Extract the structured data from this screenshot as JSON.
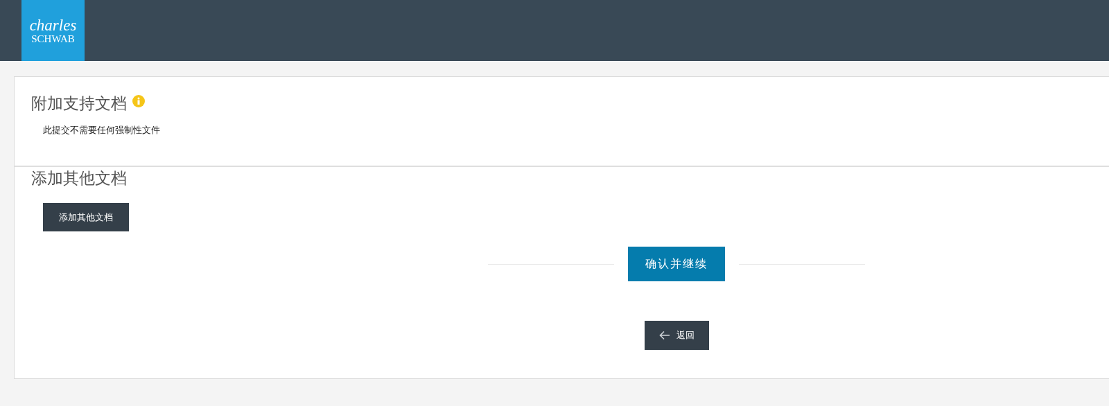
{
  "header": {
    "logo": {
      "line_1": "charles",
      "line_2": "SCHWAB"
    }
  },
  "required_documents": {
    "title": "附加支持文档",
    "info_icon": true,
    "message": "此提交不需要任何强制性文件"
  },
  "other_documents": {
    "title": "添加其他文档",
    "button": "添加其他文档"
  },
  "actions": {
    "confirm_button": "确认并继续",
    "back_button": "返回"
  }
}
